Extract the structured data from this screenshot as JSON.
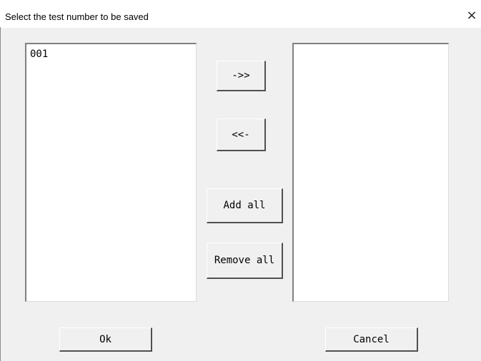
{
  "window": {
    "title": "Select the test number to be saved",
    "close_symbol": "×"
  },
  "left_list": {
    "items": [
      "001"
    ]
  },
  "right_list": {
    "items": []
  },
  "buttons": {
    "add": "->>",
    "remove": "<<-",
    "add_all": "Add all",
    "remove_all": "Remove all",
    "ok": "Ok",
    "cancel": "Cancel"
  },
  "icons": {
    "close": "close-icon"
  }
}
